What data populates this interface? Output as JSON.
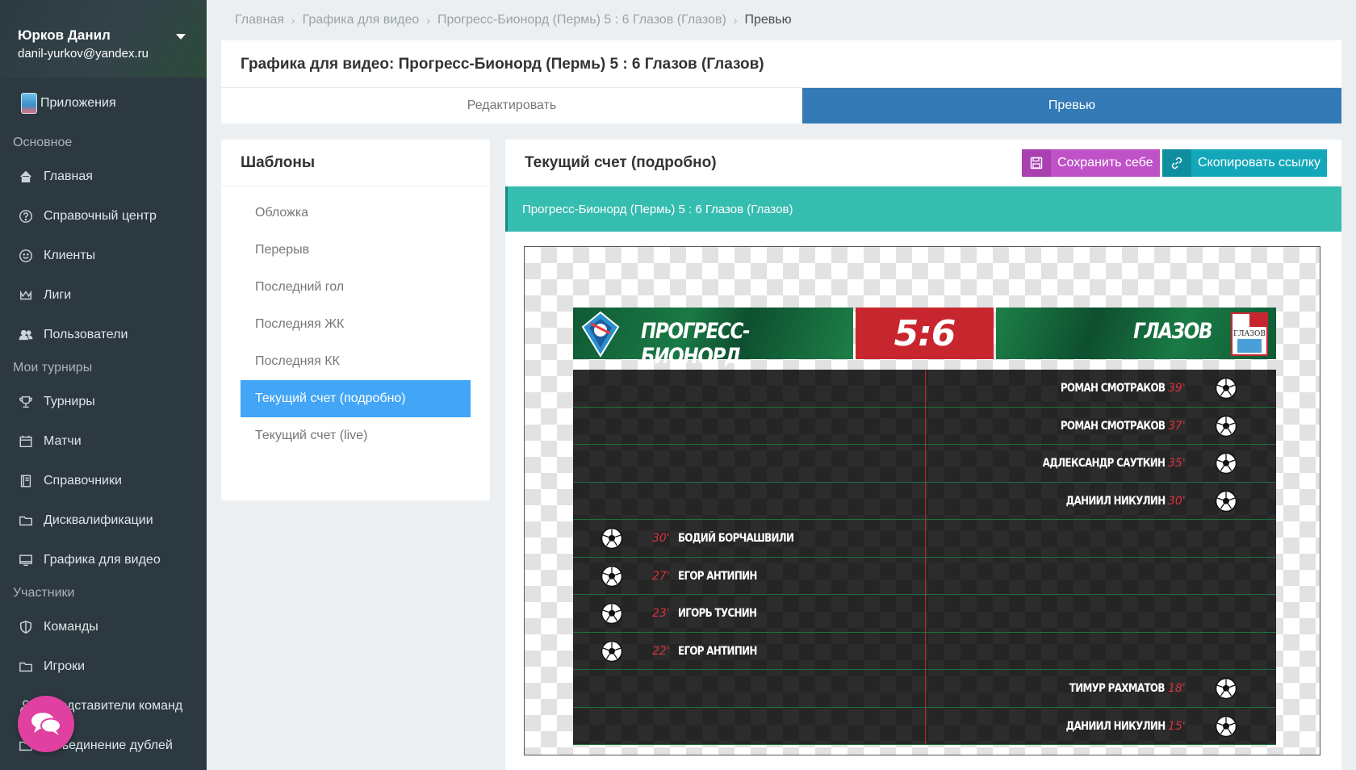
{
  "user": {
    "name": "Юрков Данил",
    "email": "danil-yurkov@yandex.ru"
  },
  "sidebar": {
    "apps_label": "Приложения",
    "sections": {
      "main": "Основное",
      "tournaments": "Мои турниры",
      "participants": "Участники"
    },
    "items": {
      "home": "Главная",
      "help": "Справочный центр",
      "clients": "Клиенты",
      "leagues": "Лиги",
      "users": "Пользователи",
      "tournaments": "Турниры",
      "matches": "Матчи",
      "references": "Справочники",
      "disqualifications": "Дисквалификации",
      "video_graphics": "Графика для видео",
      "teams": "Команды",
      "players": "Игроки",
      "team_reps": "Представители команд",
      "merge_duplicates": "Объединение дублей"
    }
  },
  "breadcrumb": [
    "Главная",
    "Графика для видео",
    "Прогресс-Бионорд (Пермь) 5 : 6 Глазов (Глазов)",
    "Превью"
  ],
  "page": {
    "title": "Графика для видео: Прогресс-Бионорд (Пермь) 5 : 6 Глазов (Глазов)",
    "tabs": {
      "edit": "Редактировать",
      "preview": "Превью"
    }
  },
  "templates": {
    "title": "Шаблоны",
    "items": [
      "Обложка",
      "Перерыв",
      "Последний гол",
      "Последняя ЖК",
      "Последняя КК",
      "Текущий счет (подробно)",
      "Текущий счет (live)"
    ],
    "active_index": 5
  },
  "preview": {
    "title": "Текущий счет (подробно)",
    "save_label": "Сохранить себе",
    "copy_label": "Скопировать ссылку",
    "match_label": "Прогресс-Бионорд (Пермь) 5 : 6 Глазов (Глазов)"
  },
  "graphic": {
    "home_team": "ПРОГРЕСС-БИОНОРД",
    "away_team": "ГЛАЗОВ",
    "away_logo_text": "ГЛАЗОВ",
    "score": "5:6",
    "events": [
      {
        "side": "away",
        "player": "РОМАН СМОТРАКОВ",
        "minute": "39'"
      },
      {
        "side": "away",
        "player": "РОМАН СМОТРАКОВ",
        "minute": "37'"
      },
      {
        "side": "away",
        "player": "АДЛЕКСАНДР САУТКИН",
        "minute": "35'"
      },
      {
        "side": "away",
        "player": "ДАНИИЛ НИКУЛИН",
        "minute": "30'"
      },
      {
        "side": "home",
        "player": "БОДИЙ БОРЧАШВИЛИ",
        "minute": "30'"
      },
      {
        "side": "home",
        "player": "ЕГОР АНТИПИН",
        "minute": "27'"
      },
      {
        "side": "home",
        "player": "ИГОРЬ ТУСНИН",
        "minute": "23'"
      },
      {
        "side": "home",
        "player": "ЕГОР АНТИПИН",
        "minute": "22'"
      },
      {
        "side": "away",
        "player": "ТИМУР РАХМАТОВ",
        "minute": "18'"
      },
      {
        "side": "away",
        "player": "ДАНИИЛ НИКУЛИН",
        "minute": "15'"
      }
    ]
  },
  "colors": {
    "sidebar": "#2c3940",
    "accent": "#337ab7",
    "template_active": "#42a5f5",
    "teal": "#35bdb0",
    "save": "#c052c8",
    "copy": "#14a7ba",
    "score_red": "#c8262f"
  }
}
